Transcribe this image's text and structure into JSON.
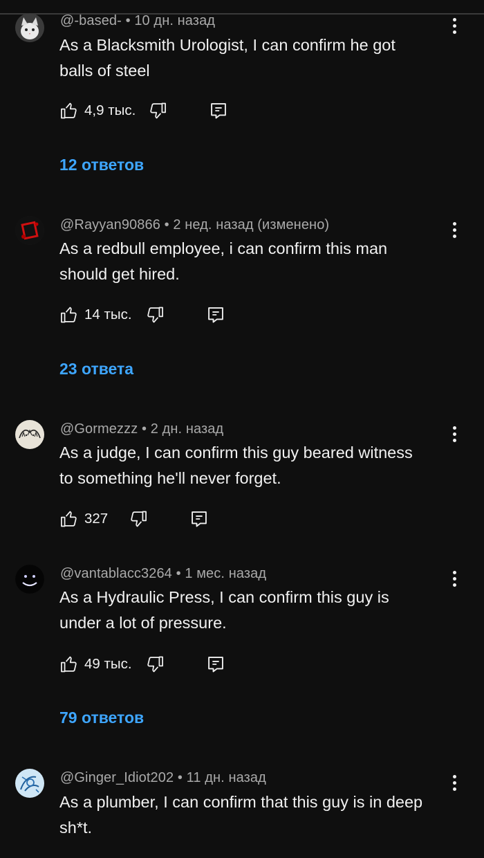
{
  "comments": [
    {
      "author": "@-based-",
      "time": "10 дн. назад",
      "edited": "",
      "meta": "@-based- • 10 дн. назад",
      "text_lines": [
        "As a Blacksmith Urologist, I can confirm he got",
        "balls of steel"
      ],
      "likes": "4,9 тыс.",
      "replies": "12 ответов",
      "avatar": "cat-avatar"
    },
    {
      "author": "@Rayyan90866",
      "time": "2 нед. назад",
      "edited": "(изменено)",
      "meta": "@Rayyan90866 • 2 нед. назад (изменено)",
      "text_lines": [
        "As a redbull employee, i can confirm this man",
        "should get hired."
      ],
      "likes": "14 тыс.",
      "replies": "23 ответа",
      "avatar": "red-square-avatar"
    },
    {
      "author": "@Gormezzz",
      "time": "2 дн. назад",
      "edited": "",
      "meta": "@Gormezzz • 2 дн. назад",
      "text_lines": [
        "As a judge, I can confirm this guy beared witness",
        "to something he'll never forget."
      ],
      "likes": "327",
      "replies": "",
      "avatar": "sketch-avatar"
    },
    {
      "author": "@vantablacc3264",
      "time": "1 мес. назад",
      "edited": "",
      "meta": "@vantablacc3264 • 1 мес. назад",
      "text_lines": [
        "As a Hydraulic Press, I can confirm this guy is",
        "under a lot of pressure."
      ],
      "likes": "49 тыс.",
      "replies": "79 ответов",
      "avatar": "dark-face-avatar"
    },
    {
      "author": "@Ginger_Idiot202",
      "time": "11 дн. назад",
      "edited": "",
      "meta": "@Ginger_Idiot202 • 11 дн. назад",
      "text_lines": [
        "As a plumber, I can confirm that this guy is in deep",
        "sh*t."
      ],
      "likes": "",
      "replies": "",
      "avatar": "blue-drawing-avatar"
    }
  ],
  "icons": {
    "like": "thumb-up-icon",
    "dislike": "thumb-down-icon",
    "reply": "reply-icon",
    "menu": "more-vert-icon"
  },
  "colors": {
    "background": "#0f0f0f",
    "text": "#f1f1f1",
    "meta": "#aaaaaa",
    "link": "#3ea6ff"
  }
}
